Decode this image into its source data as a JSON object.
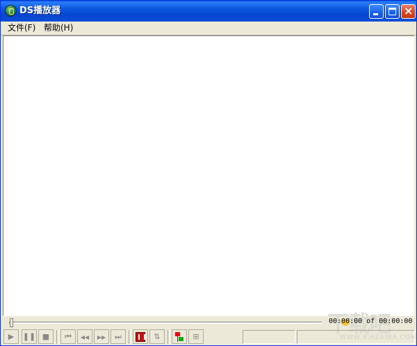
{
  "window": {
    "title": "DS播放器"
  },
  "menu": {
    "file": "文件(F)",
    "help": "帮助(H)"
  },
  "player": {
    "time_display": "00:00:00 of 00:00:00",
    "seek_position": 0
  },
  "toolbar": {
    "play_icon": "play-icon",
    "pause_icon": "pause-icon",
    "stop_icon": "stop-icon",
    "prev_icon": "skip-back-icon",
    "rewind_icon": "rewind-icon",
    "forward_icon": "fast-forward-icon",
    "next_icon": "skip-forward-icon",
    "glyph_play": "▶",
    "glyph_pause": "❚❚",
    "glyph_stop": "■",
    "glyph_prev": "⏮",
    "glyph_rewind": "◀◀",
    "glyph_forward": "▶▶",
    "glyph_next": "⏭",
    "glyph_swap": "⇅",
    "glyph_fit": "⊞"
  },
  "watermark": {
    "text": "下载吧",
    "sub": "WWW.XIAZAIBA.COM"
  },
  "colors": {
    "titlebar": "#0645cf",
    "close": "#d2461f",
    "face": "#ece9d8"
  }
}
